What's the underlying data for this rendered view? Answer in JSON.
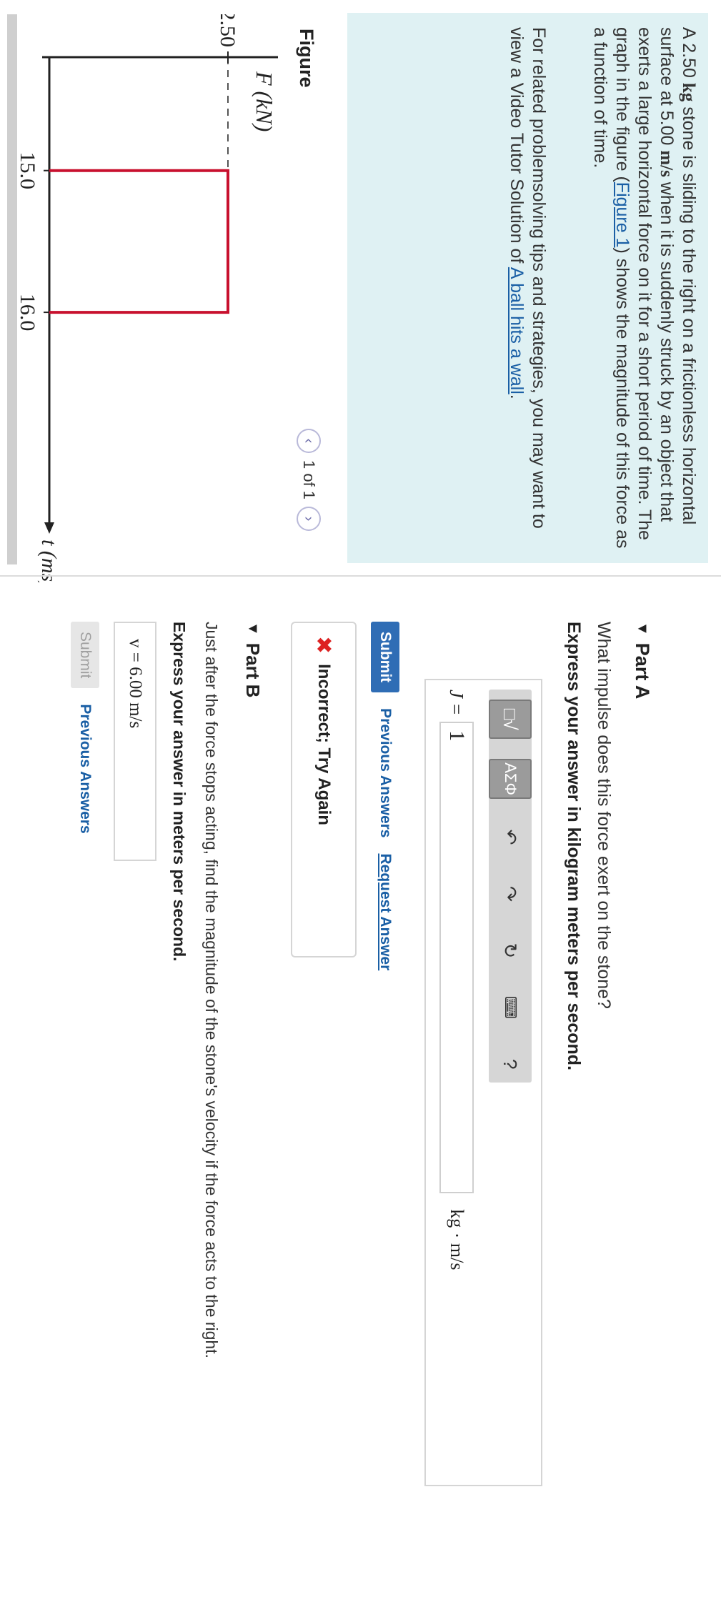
{
  "intro": {
    "text_prefix": "A 2.50 ",
    "mass_unit": "kg",
    "text_mid1": " stone is sliding to the right on a frictionless horizontal surface at 5.00 ",
    "speed_unit": "m/s",
    "text_mid2": " when it is suddenly struck by an object that exerts a large horizontal force on it for a short period of time. The graph in the figure (",
    "figure_link": "Figure 1",
    "text_end": ") shows the magnitude of this force as a function of time.",
    "related_prefix": "For related problemsolving tips and strategies, you may want to view a Video Tutor Solution of ",
    "video_link": "A ball hits a wall",
    "related_end": "."
  },
  "figure": {
    "title": "Figure",
    "pager_text": "1 of 1",
    "prev_icon": "chevron-left-icon",
    "next_icon": "chevron-right-icon"
  },
  "chart_data": {
    "type": "line",
    "ylabel": "F (kN)",
    "xlabel": "t (ms)",
    "yticks": [
      "2.50"
    ],
    "xticks": [
      "15.0",
      "16.0"
    ],
    "x": [
      15.0,
      15.0,
      16.0,
      16.0
    ],
    "y": [
      0,
      2.5,
      2.5,
      0
    ],
    "line_color": "#c8102e"
  },
  "partA": {
    "header": "Part A",
    "question": "What impulse does this force exert on the stone?",
    "instruction": "Express your answer in kilogram meters per second.",
    "toolbar": {
      "templates": "templates-icon",
      "symbols": "ΑΣΦ",
      "undo": "↶",
      "redo": "↷",
      "reset": "↻",
      "keyboard": "keyboard-icon",
      "help": "?"
    },
    "variable": "J",
    "equals": "=",
    "input_value": "1",
    "unit": "kg · m/s",
    "submit": "Submit",
    "previous_answers": "Previous Answers",
    "request_answer": "Request Answer",
    "feedback": "Incorrect; Try Again"
  },
  "partB": {
    "header": "Part B",
    "question": "Just after the force stops acting, find the magnitude of the stone's velocity if the force acts to the right.",
    "instruction": "Express your answer in meters per second.",
    "field": "v = 6.00 m/s",
    "submit": "Submit",
    "previous_answers": "Previous Answers"
  },
  "colors": {
    "accent": "#2f6db5",
    "intro_bg": "#dff1f3",
    "error": "#dd2222"
  }
}
